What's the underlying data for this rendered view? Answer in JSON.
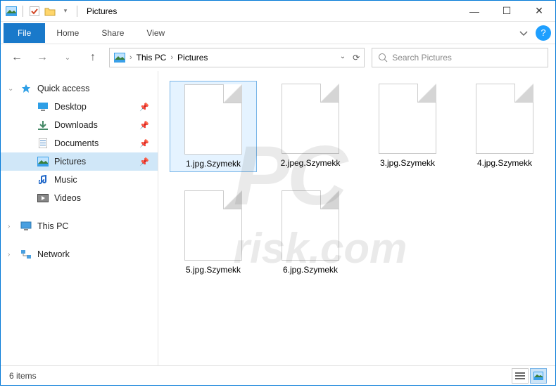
{
  "titlebar": {
    "title": "Pictures"
  },
  "sys": {
    "min": "—",
    "max": "☐",
    "close": "✕"
  },
  "ribbon": {
    "file": "File",
    "tabs": [
      "Home",
      "Share",
      "View"
    ]
  },
  "address": {
    "segments": [
      "This PC",
      "Pictures"
    ]
  },
  "search": {
    "placeholder": "Search Pictures"
  },
  "sidebar": {
    "quick": {
      "label": "Quick access",
      "items": [
        {
          "label": "Desktop",
          "icon": "desktop",
          "pin": true
        },
        {
          "label": "Downloads",
          "icon": "downloads",
          "pin": true
        },
        {
          "label": "Documents",
          "icon": "documents",
          "pin": true
        },
        {
          "label": "Pictures",
          "icon": "pictures",
          "pin": true,
          "selected": true
        },
        {
          "label": "Music",
          "icon": "music",
          "pin": false
        },
        {
          "label": "Videos",
          "icon": "videos",
          "pin": false
        }
      ]
    },
    "thispc": {
      "label": "This PC"
    },
    "network": {
      "label": "Network"
    }
  },
  "files": [
    {
      "name": "1.jpg.Szymekk",
      "selected": true
    },
    {
      "name": "2.jpeg.Szymekk"
    },
    {
      "name": "3.jpg.Szymekk"
    },
    {
      "name": "4.jpg.Szymekk"
    },
    {
      "name": "5.jpg.Szymekk"
    },
    {
      "name": "6.jpg.Szymekk"
    }
  ],
  "status": {
    "text": "6 items"
  }
}
